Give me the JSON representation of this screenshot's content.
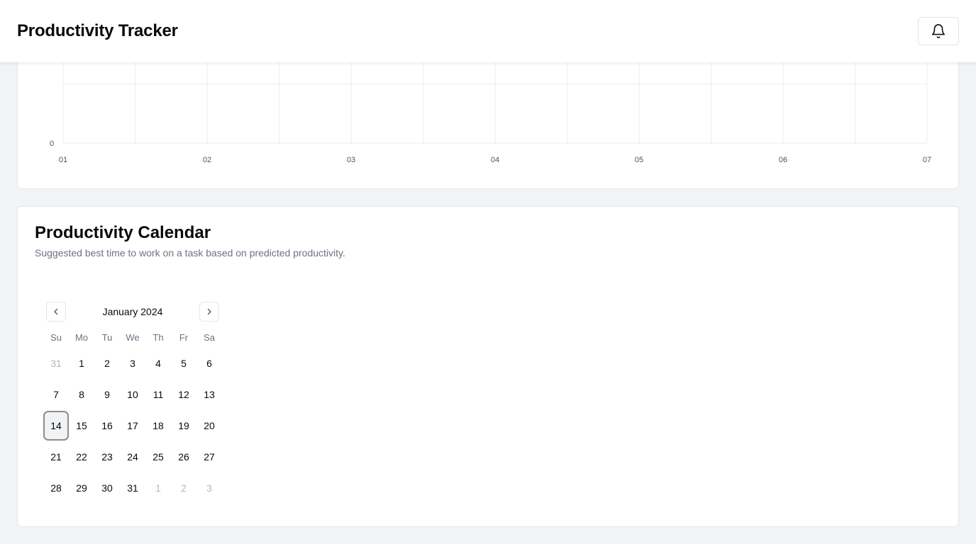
{
  "header": {
    "title": "Productivity Tracker",
    "notification_icon": "bell-icon"
  },
  "chart_data": {
    "type": "line",
    "categories": [
      "01",
      "02",
      "03",
      "04",
      "05",
      "06",
      "07"
    ],
    "y_ticks": [
      "0"
    ],
    "series": [],
    "grid": true
  },
  "calendar": {
    "title": "Productivity Calendar",
    "subtitle": "Suggested best time to work on a task based on predicted productivity.",
    "month_label": "January 2024",
    "prev_icon": "chevron-left-icon",
    "next_icon": "chevron-right-icon",
    "weekdays": [
      "Su",
      "Mo",
      "Tu",
      "We",
      "Th",
      "Fr",
      "Sa"
    ],
    "weeks": [
      [
        {
          "d": "31",
          "out": true
        },
        {
          "d": "1"
        },
        {
          "d": "2"
        },
        {
          "d": "3"
        },
        {
          "d": "4"
        },
        {
          "d": "5"
        },
        {
          "d": "6"
        }
      ],
      [
        {
          "d": "7"
        },
        {
          "d": "8"
        },
        {
          "d": "9"
        },
        {
          "d": "10"
        },
        {
          "d": "11"
        },
        {
          "d": "12"
        },
        {
          "d": "13"
        }
      ],
      [
        {
          "d": "14",
          "today": true
        },
        {
          "d": "15"
        },
        {
          "d": "16"
        },
        {
          "d": "17"
        },
        {
          "d": "18"
        },
        {
          "d": "19"
        },
        {
          "d": "20"
        }
      ],
      [
        {
          "d": "21"
        },
        {
          "d": "22"
        },
        {
          "d": "23"
        },
        {
          "d": "24"
        },
        {
          "d": "25"
        },
        {
          "d": "26"
        },
        {
          "d": "27"
        }
      ],
      [
        {
          "d": "28"
        },
        {
          "d": "29"
        },
        {
          "d": "30"
        },
        {
          "d": "31"
        },
        {
          "d": "1",
          "out": true
        },
        {
          "d": "2",
          "out": true
        },
        {
          "d": "3",
          "out": true
        }
      ]
    ]
  }
}
